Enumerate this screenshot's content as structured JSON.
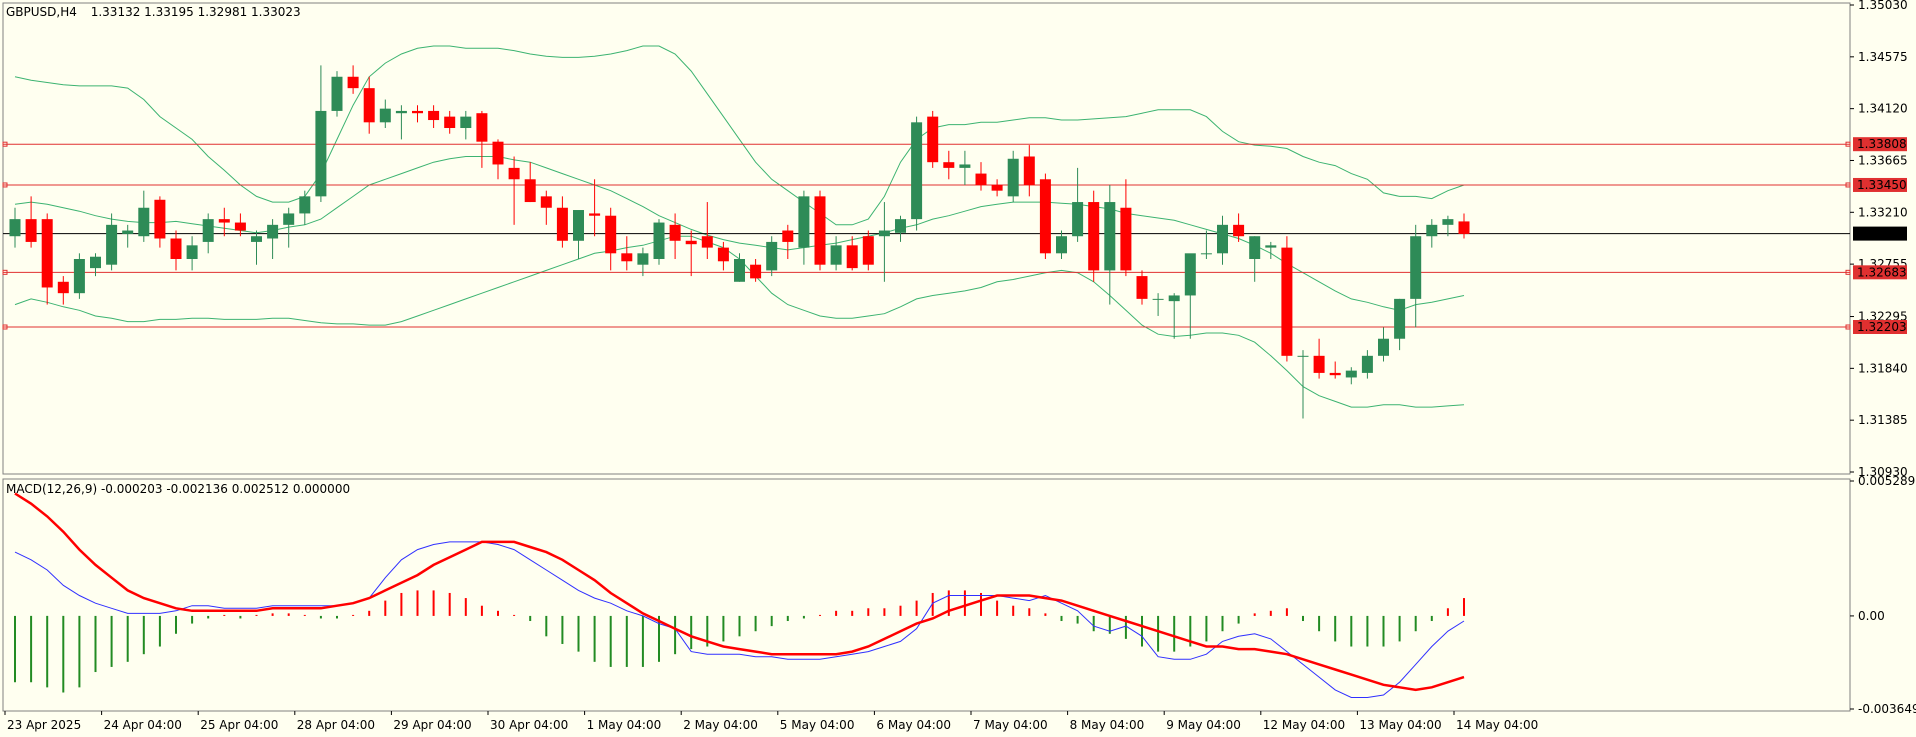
{
  "header": {
    "symbol": "GBPUSD,H4",
    "ohlc": "1.33132 1.33195 1.32981 1.33023",
    "macd_title": "MACD(12,26,9) -0.000203 -0.002136 0.002512 0.000000"
  },
  "colors": {
    "background": "#FFFFF0",
    "bull": "#2E8B57",
    "bear": "#FF0000",
    "bands": "#3CB371",
    "hline": "#E03030",
    "price_line": "#000000",
    "macd_line": "#3030FF",
    "signal_line": "#FF0000",
    "hist_up": "#FF0000",
    "hist_down": "#228B22"
  },
  "chart_data": [
    {
      "type": "candlestick",
      "symbol": "GBPUSD",
      "timeframe": "H4",
      "ylim": [
        1.3093,
        1.3503
      ],
      "y_ticks": [
        "1.35030",
        "1.34575",
        "1.34120",
        "1.33665",
        "1.33210",
        "1.32755",
        "1.32295",
        "1.31840",
        "1.31385",
        "1.30930"
      ],
      "x_ticks": [
        "23 Apr 2025",
        "24 Apr 04:00",
        "25 Apr 04:00",
        "28 Apr 04:00",
        "29 Apr 04:00",
        "30 Apr 04:00",
        "1 May 04:00",
        "2 May 04:00",
        "5 May 04:00",
        "6 May 04:00",
        "7 May 04:00",
        "8 May 04:00",
        "9 May 04:00",
        "12 May 04:00",
        "13 May 04:00",
        "14 May 04:00"
      ],
      "x_tick_index": [
        0,
        6,
        12,
        18,
        24,
        30,
        36,
        42,
        48,
        54,
        60,
        66,
        72,
        78,
        84,
        90
      ],
      "current_price": "1.33023",
      "levels": [
        "1.33808",
        "1.33450",
        "1.32683",
        "1.32203"
      ],
      "candles": [
        [
          1.33,
          1.3325,
          1.329,
          1.3315
        ],
        [
          1.3315,
          1.3335,
          1.329,
          1.3295
        ],
        [
          1.3315,
          1.332,
          1.324,
          1.3255
        ],
        [
          1.326,
          1.3265,
          1.324,
          1.325
        ],
        [
          1.325,
          1.3285,
          1.3245,
          1.328
        ],
        [
          1.3272,
          1.3285,
          1.3265,
          1.3282
        ],
        [
          1.3275,
          1.332,
          1.327,
          1.331
        ],
        [
          1.3302,
          1.331,
          1.329,
          1.3305
        ],
        [
          1.33,
          1.334,
          1.3295,
          1.3325
        ],
        [
          1.3332,
          1.3335,
          1.329,
          1.3298
        ],
        [
          1.3298,
          1.3305,
          1.327,
          1.328
        ],
        [
          1.328,
          1.33,
          1.327,
          1.3292
        ],
        [
          1.3295,
          1.332,
          1.3285,
          1.3315
        ],
        [
          1.3315,
          1.3325,
          1.33,
          1.3312
        ],
        [
          1.3312,
          1.332,
          1.33,
          1.3305
        ],
        [
          1.3295,
          1.3305,
          1.3275,
          1.33
        ],
        [
          1.3298,
          1.3315,
          1.328,
          1.331
        ],
        [
          1.331,
          1.3325,
          1.329,
          1.332
        ],
        [
          1.332,
          1.334,
          1.331,
          1.3335
        ],
        [
          1.3335,
          1.345,
          1.333,
          1.341
        ],
        [
          1.341,
          1.3445,
          1.3405,
          1.344
        ],
        [
          1.344,
          1.345,
          1.3425,
          1.343
        ],
        [
          1.343,
          1.344,
          1.339,
          1.34
        ],
        [
          1.34,
          1.342,
          1.3395,
          1.3412
        ],
        [
          1.3408,
          1.3415,
          1.3385,
          1.341
        ],
        [
          1.341,
          1.3415,
          1.34,
          1.3408
        ],
        [
          1.341,
          1.3415,
          1.3395,
          1.3402
        ],
        [
          1.3405,
          1.341,
          1.339,
          1.3395
        ],
        [
          1.3395,
          1.341,
          1.3385,
          1.3405
        ],
        [
          1.3408,
          1.341,
          1.336,
          1.3383
        ],
        [
          1.3383,
          1.3385,
          1.335,
          1.3363
        ],
        [
          1.336,
          1.337,
          1.331,
          1.335
        ],
        [
          1.335,
          1.3365,
          1.333,
          1.333
        ],
        [
          1.3335,
          1.334,
          1.331,
          1.3325
        ],
        [
          1.3325,
          1.3335,
          1.329,
          1.3296
        ],
        [
          1.3296,
          1.3315,
          1.328,
          1.3323
        ],
        [
          1.332,
          1.335,
          1.33,
          1.3318
        ],
        [
          1.3318,
          1.3325,
          1.327,
          1.3285
        ],
        [
          1.3285,
          1.33,
          1.327,
          1.3278
        ],
        [
          1.3275,
          1.329,
          1.3265,
          1.3285
        ],
        [
          1.328,
          1.3315,
          1.3275,
          1.3312
        ],
        [
          1.331,
          1.332,
          1.328,
          1.3296
        ],
        [
          1.3296,
          1.3305,
          1.3265,
          1.3293
        ],
        [
          1.33,
          1.333,
          1.328,
          1.329
        ],
        [
          1.329,
          1.3295,
          1.327,
          1.3278
        ],
        [
          1.326,
          1.3285,
          1.326,
          1.328
        ],
        [
          1.3275,
          1.328,
          1.326,
          1.3263
        ],
        [
          1.327,
          1.33,
          1.3265,
          1.3295
        ],
        [
          1.3305,
          1.331,
          1.328,
          1.3295
        ],
        [
          1.329,
          1.334,
          1.3275,
          1.3335
        ],
        [
          1.3335,
          1.334,
          1.327,
          1.3275
        ],
        [
          1.3275,
          1.33,
          1.327,
          1.3292
        ],
        [
          1.3292,
          1.33,
          1.327,
          1.3272
        ],
        [
          1.33,
          1.3305,
          1.327,
          1.3275
        ],
        [
          1.33,
          1.333,
          1.326,
          1.3305
        ],
        [
          1.3303,
          1.3318,
          1.3295,
          1.3315
        ],
        [
          1.3315,
          1.3405,
          1.3305,
          1.34
        ],
        [
          1.3405,
          1.341,
          1.336,
          1.3365
        ],
        [
          1.3365,
          1.3375,
          1.335,
          1.336
        ],
        [
          1.336,
          1.3375,
          1.3345,
          1.3363
        ],
        [
          1.3355,
          1.3365,
          1.334,
          1.3345
        ],
        [
          1.3345,
          1.335,
          1.3335,
          1.334
        ],
        [
          1.3335,
          1.3375,
          1.333,
          1.3368
        ],
        [
          1.337,
          1.338,
          1.3335,
          1.3345
        ],
        [
          1.335,
          1.3355,
          1.328,
          1.3285
        ],
        [
          1.3285,
          1.3305,
          1.328,
          1.33
        ],
        [
          1.33,
          1.336,
          1.3295,
          1.333
        ],
        [
          1.333,
          1.334,
          1.326,
          1.327
        ],
        [
          1.327,
          1.3345,
          1.324,
          1.333
        ],
        [
          1.3325,
          1.335,
          1.3265,
          1.327
        ],
        [
          1.3265,
          1.327,
          1.324,
          1.3245
        ],
        [
          1.3245,
          1.325,
          1.323,
          1.3245
        ],
        [
          1.3243,
          1.325,
          1.321,
          1.3248
        ],
        [
          1.3248,
          1.3255,
          1.321,
          1.3285
        ],
        [
          1.3285,
          1.3305,
          1.328,
          1.3285
        ],
        [
          1.3285,
          1.3318,
          1.3275,
          1.331
        ],
        [
          1.331,
          1.332,
          1.3295,
          1.33
        ],
        [
          1.328,
          1.33,
          1.326,
          1.33
        ],
        [
          1.329,
          1.3295,
          1.328,
          1.3292
        ],
        [
          1.329,
          1.33,
          1.319,
          1.3195
        ],
        [
          1.3195,
          1.32,
          1.314,
          1.3195
        ],
        [
          1.3195,
          1.321,
          1.3175,
          1.318
        ],
        [
          1.318,
          1.319,
          1.3175,
          1.3178
        ],
        [
          1.3176,
          1.3185,
          1.317,
          1.3182
        ],
        [
          1.318,
          1.32,
          1.3175,
          1.3195
        ],
        [
          1.3195,
          1.322,
          1.319,
          1.321
        ],
        [
          1.321,
          1.3245,
          1.32,
          1.3245
        ],
        [
          1.3245,
          1.331,
          1.322,
          1.33
        ],
        [
          1.33,
          1.3315,
          1.329,
          1.331
        ],
        [
          1.331,
          1.3318,
          1.33,
          1.3315
        ],
        [
          1.3313,
          1.332,
          1.3298,
          1.3302
        ]
      ],
      "bands_upper": [
        1.344,
        1.3437,
        1.3435,
        1.3433,
        1.3432,
        1.3432,
        1.3432,
        1.343,
        1.342,
        1.3405,
        1.3395,
        1.3385,
        1.337,
        1.3358,
        1.3345,
        1.3335,
        1.333,
        1.333,
        1.3335,
        1.3355,
        1.3385,
        1.3415,
        1.344,
        1.3452,
        1.346,
        1.3465,
        1.3467,
        1.3467,
        1.3465,
        1.3465,
        1.3465,
        1.3463,
        1.346,
        1.3458,
        1.3457,
        1.3457,
        1.3458,
        1.346,
        1.3463,
        1.3467,
        1.3467,
        1.346,
        1.3445,
        1.3425,
        1.3405,
        1.3385,
        1.3365,
        1.335,
        1.334,
        1.333,
        1.332,
        1.331,
        1.331,
        1.3315,
        1.3335,
        1.3365,
        1.3385,
        1.3395,
        1.3398,
        1.3398,
        1.34,
        1.34,
        1.3402,
        1.3404,
        1.3404,
        1.3402,
        1.3402,
        1.3403,
        1.3404,
        1.3405,
        1.3408,
        1.3411,
        1.3411,
        1.3411,
        1.3405,
        1.3392,
        1.3383,
        1.338,
        1.3379,
        1.3377,
        1.337,
        1.3365,
        1.3362,
        1.3355,
        1.335,
        1.3338,
        1.3335,
        1.3335,
        1.3333,
        1.334,
        1.3345
      ],
      "bands_middle": [
        1.3328,
        1.333,
        1.3328,
        1.3325,
        1.3322,
        1.3318,
        1.3315,
        1.3313,
        1.3312,
        1.3312,
        1.3313,
        1.3311,
        1.3309,
        1.3307,
        1.3305,
        1.3303,
        1.3305,
        1.3308,
        1.331,
        1.3315,
        1.3325,
        1.3335,
        1.3345,
        1.335,
        1.3355,
        1.336,
        1.3365,
        1.3368,
        1.337,
        1.337,
        1.337,
        1.3367,
        1.3365,
        1.336,
        1.3355,
        1.335,
        1.3345,
        1.334,
        1.3333,
        1.3326,
        1.3318,
        1.3312,
        1.3306,
        1.3301,
        1.3297,
        1.3294,
        1.3292,
        1.329,
        1.3288,
        1.329,
        1.3292,
        1.3294,
        1.3297,
        1.33,
        1.3303,
        1.3307,
        1.331,
        1.3315,
        1.3318,
        1.3322,
        1.3326,
        1.3328,
        1.333,
        1.333,
        1.333,
        1.3329,
        1.3328,
        1.3326,
        1.3324,
        1.332,
        1.3318,
        1.3316,
        1.3314,
        1.331,
        1.3306,
        1.3302,
        1.3298,
        1.3292,
        1.3285,
        1.3276,
        1.3268,
        1.326,
        1.3252,
        1.3245,
        1.3242,
        1.3238,
        1.3235,
        1.324,
        1.3242,
        1.3245,
        1.3248
      ],
      "bands_lower": [
        1.324,
        1.3245,
        1.3242,
        1.3238,
        1.3235,
        1.323,
        1.3228,
        1.3225,
        1.3225,
        1.3227,
        1.3227,
        1.3228,
        1.3228,
        1.3227,
        1.3227,
        1.3227,
        1.3228,
        1.3228,
        1.3226,
        1.3224,
        1.3223,
        1.3223,
        1.3222,
        1.3222,
        1.3225,
        1.323,
        1.3235,
        1.324,
        1.3245,
        1.325,
        1.3255,
        1.326,
        1.3265,
        1.327,
        1.3275,
        1.328,
        1.3285,
        1.3287,
        1.329,
        1.3292,
        1.3296,
        1.33,
        1.33,
        1.3295,
        1.329,
        1.328,
        1.3265,
        1.325,
        1.324,
        1.3235,
        1.323,
        1.3228,
        1.3228,
        1.323,
        1.3232,
        1.3238,
        1.3245,
        1.3248,
        1.325,
        1.3252,
        1.3255,
        1.326,
        1.3262,
        1.3265,
        1.3268,
        1.327,
        1.3268,
        1.326,
        1.3248,
        1.3235,
        1.3222,
        1.3214,
        1.3212,
        1.3213,
        1.3215,
        1.3215,
        1.3213,
        1.3207,
        1.3195,
        1.3182,
        1.3168,
        1.316,
        1.3155,
        1.315,
        1.315,
        1.3152,
        1.3152,
        1.315,
        1.315,
        1.3151,
        1.3152
      ]
    },
    {
      "type": "macd",
      "params": "12,26,9",
      "ylim": [
        -0.003649,
        0.005289
      ],
      "y_ticks": [
        "0.005289",
        "0.00",
        "-0.003649"
      ],
      "main": [
        0.0025,
        0.0022,
        0.0018,
        0.0012,
        0.0008,
        0.0005,
        0.0003,
        0.0001,
        0.0001,
        0.0001,
        0.0002,
        0.0004,
        0.0004,
        0.0003,
        0.0003,
        0.0003,
        0.0004,
        0.0004,
        0.0004,
        0.0004,
        0.0004,
        0.0005,
        0.0007,
        0.0015,
        0.0022,
        0.0026,
        0.0028,
        0.0029,
        0.0029,
        0.0029,
        0.0028,
        0.0026,
        0.0022,
        0.0018,
        0.0014,
        0.001,
        0.0007,
        0.0005,
        0.0002,
        0.0,
        -0.0003,
        -0.0005,
        -0.0014,
        -0.0015,
        -0.0015,
        -0.0015,
        -0.0016,
        -0.0016,
        -0.0017,
        -0.0017,
        -0.0017,
        -0.0016,
        -0.0015,
        -0.0014,
        -0.0012,
        -0.001,
        -0.0005,
        0.0005,
        0.0008,
        0.0008,
        0.0008,
        0.0008,
        0.0007,
        0.0006,
        0.0008,
        0.0005,
        0.0002,
        -0.0004,
        -0.0006,
        -0.0004,
        -0.0008,
        -0.0016,
        -0.0017,
        -0.0017,
        -0.0015,
        -0.001,
        -0.0008,
        -0.0007,
        -0.0009,
        -0.0014,
        -0.0019,
        -0.0024,
        -0.0029,
        -0.0032,
        -0.0032,
        -0.0031,
        -0.0026,
        -0.0019,
        -0.0012,
        -0.0006,
        -0.0002
      ],
      "signal": [
        0.0048,
        0.0044,
        0.0039,
        0.0033,
        0.0026,
        0.002,
        0.0015,
        0.001,
        0.0007,
        0.0005,
        0.0003,
        0.0002,
        0.0002,
        0.0002,
        0.0002,
        0.0002,
        0.0003,
        0.0003,
        0.0003,
        0.0003,
        0.0004,
        0.0005,
        0.0007,
        0.001,
        0.0013,
        0.0016,
        0.002,
        0.0023,
        0.0026,
        0.0029,
        0.0029,
        0.0029,
        0.0027,
        0.0025,
        0.0022,
        0.0018,
        0.0014,
        0.0009,
        0.0005,
        0.0001,
        -0.0002,
        -0.0005,
        -0.0008,
        -0.001,
        -0.0012,
        -0.0013,
        -0.0014,
        -0.0015,
        -0.0015,
        -0.0015,
        -0.0015,
        -0.0015,
        -0.0014,
        -0.0012,
        -0.0009,
        -0.0006,
        -0.0003,
        -0.0001,
        0.0002,
        0.0004,
        0.0006,
        0.0008,
        0.0008,
        0.0008,
        0.0007,
        0.0006,
        0.0004,
        0.0002,
        0.0,
        -0.0002,
        -0.0004,
        -0.0006,
        -0.0008,
        -0.001,
        -0.0012,
        -0.0012,
        -0.0013,
        -0.0013,
        -0.0014,
        -0.0015,
        -0.0017,
        -0.0019,
        -0.0021,
        -0.0023,
        -0.0025,
        -0.0027,
        -0.0028,
        -0.0029,
        -0.0028,
        -0.0026,
        -0.0024
      ],
      "histogram": [
        -0.0026,
        -0.0026,
        -0.0028,
        -0.003,
        -0.0028,
        -0.0022,
        -0.002,
        -0.0018,
        -0.0015,
        -0.0012,
        -0.0007,
        -0.0003,
        -0.0001,
        0.0,
        -0.0001,
        0.0,
        0.0001,
        0.0001,
        0.0,
        -0.0001,
        -0.0001,
        0.0,
        0.0002,
        0.0006,
        0.0009,
        0.001,
        0.001,
        0.0009,
        0.0007,
        0.0004,
        0.0002,
        0.0,
        -0.0002,
        -0.0008,
        -0.0011,
        -0.0014,
        -0.0018,
        -0.002,
        -0.002,
        -0.002,
        -0.0018,
        -0.0015,
        -0.0013,
        -0.0012,
        -0.001,
        -0.0008,
        -0.0006,
        -0.0004,
        -0.0002,
        -0.0001,
        0.0,
        0.0002,
        0.0002,
        0.0003,
        0.0003,
        0.0004,
        0.0006,
        0.0009,
        0.001,
        0.001,
        0.0009,
        0.0006,
        0.0004,
        0.0003,
        0.0001,
        -0.0002,
        -0.0003,
        -0.0006,
        -0.0007,
        -0.0009,
        -0.0012,
        -0.0014,
        -0.0014,
        -0.0012,
        -0.001,
        -0.0006,
        -0.0003,
        0.0001,
        0.0002,
        0.0003,
        -0.0002,
        -0.0006,
        -0.001,
        -0.0012,
        -0.0012,
        -0.0012,
        -0.001,
        -0.0006,
        -0.0002,
        0.0003,
        0.0007
      ]
    }
  ]
}
